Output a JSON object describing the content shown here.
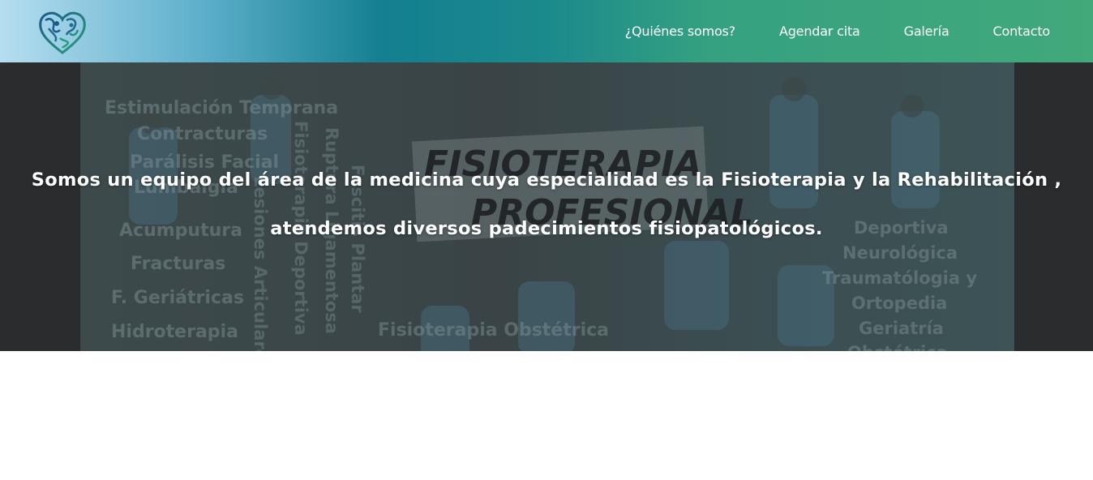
{
  "header": {
    "logo_icon": "heart-anatomy-logo-icon",
    "nav": [
      {
        "label": "¿Quiénes somos?"
      },
      {
        "label": "Agendar cita"
      },
      {
        "label": "Galería"
      },
      {
        "label": "Contacto"
      }
    ]
  },
  "hero": {
    "line1": "Somos un equipo del área de la medicina cuya especialidad es la Fisioterapia y la Rehabilitación ,",
    "line2": "atendemos diversos padecimientos fisiopatológicos.",
    "background_image": {
      "title_line1": "FISIOTERAPIA",
      "title_line2": "PROFESIONAL",
      "left_words": [
        "Estimulación Temprana",
        "Contracturas",
        "Parálisis Facial",
        "Lumbalgia",
        "Acumputura",
        "Fracturas",
        "F. Geriátricas",
        "Hidroterapia"
      ],
      "vertical_words": [
        "Lesiones Articulares",
        "Fisioterapia Deportiva",
        "Ruptura Ligamentosa",
        "Fascitis Plantar"
      ],
      "bottom_word": "Fisioterapia Obstétrica",
      "right_words": [
        "Deportiva",
        "Neurológica",
        "Traumatólogia y",
        "Ortopedia",
        "Geriatría",
        "Obstétrica"
      ]
    }
  },
  "colors": {
    "nav_gradient_start": "#b6def0",
    "nav_gradient_mid": "#137f90",
    "nav_gradient_end": "#41a97a",
    "hero_overlay": "#2a2c2e",
    "text": "#ffffff"
  }
}
